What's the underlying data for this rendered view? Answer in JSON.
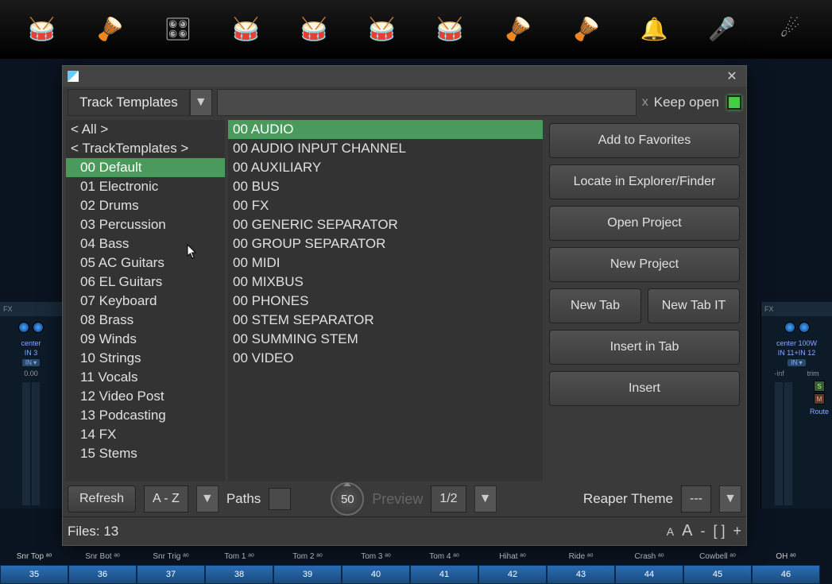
{
  "instruments": [
    "🥁",
    "🪘",
    "🎛",
    "🥁",
    "🥁",
    "🥁",
    "🥁",
    "🪘",
    "🪘",
    "🔔",
    "🎤",
    "☄"
  ],
  "dialog": {
    "type_label": "Track Templates",
    "keep_open": "Keep open",
    "search_clear": "x",
    "categories": [
      {
        "label": "< All >",
        "indent": false,
        "selected": false
      },
      {
        "label": "< TrackTemplates >",
        "indent": false,
        "selected": false
      },
      {
        "label": "00 Default",
        "indent": true,
        "selected": true
      },
      {
        "label": "01 Electronic",
        "indent": true,
        "selected": false
      },
      {
        "label": "02 Drums",
        "indent": true,
        "selected": false
      },
      {
        "label": "03 Percussion",
        "indent": true,
        "selected": false
      },
      {
        "label": "04 Bass",
        "indent": true,
        "selected": false
      },
      {
        "label": "05 AC Guitars",
        "indent": true,
        "selected": false
      },
      {
        "label": "06 EL Guitars",
        "indent": true,
        "selected": false
      },
      {
        "label": "07 Keyboard",
        "indent": true,
        "selected": false
      },
      {
        "label": "08 Brass",
        "indent": true,
        "selected": false
      },
      {
        "label": "09 Winds",
        "indent": true,
        "selected": false
      },
      {
        "label": "10 Strings",
        "indent": true,
        "selected": false
      },
      {
        "label": "11 Vocals",
        "indent": true,
        "selected": false
      },
      {
        "label": "12 Video Post",
        "indent": true,
        "selected": false
      },
      {
        "label": "13 Podcasting",
        "indent": true,
        "selected": false
      },
      {
        "label": "14 FX",
        "indent": true,
        "selected": false
      },
      {
        "label": "15 Stems",
        "indent": true,
        "selected": false
      }
    ],
    "templates": [
      {
        "label": "00 AUDIO",
        "selected": true
      },
      {
        "label": "00 AUDIO INPUT CHANNEL",
        "selected": false
      },
      {
        "label": "00 AUXILIARY",
        "selected": false
      },
      {
        "label": "00 BUS",
        "selected": false
      },
      {
        "label": "00 FX",
        "selected": false
      },
      {
        "label": "00 GENERIC SEPARATOR",
        "selected": false
      },
      {
        "label": "00 GROUP SEPARATOR",
        "selected": false
      },
      {
        "label": "00 MIDI",
        "selected": false
      },
      {
        "label": "00 MIXBUS",
        "selected": false
      },
      {
        "label": "00 PHONES",
        "selected": false
      },
      {
        "label": "00 STEM SEPARATOR",
        "selected": false
      },
      {
        "label": "00 SUMMING STEM",
        "selected": false
      },
      {
        "label": "00 VIDEO",
        "selected": false
      }
    ],
    "actions": {
      "add_fav": "Add to Favorites",
      "locate": "Locate in Explorer/Finder",
      "open_proj": "Open Project",
      "new_proj": "New Project",
      "new_tab": "New Tab",
      "new_tab_it": "New Tab IT",
      "insert_tab": "Insert in Tab",
      "insert": "Insert"
    },
    "footer": {
      "refresh": "Refresh",
      "sort": "A - Z",
      "paths": "Paths",
      "count": "50",
      "preview": "Preview",
      "fraction": "1/2",
      "theme": "Reaper Theme",
      "theme_val": "---"
    },
    "status": {
      "files": "Files: 13",
      "minus": "-",
      "brackets": "[  ]",
      "plus": "+"
    }
  },
  "left_channel": {
    "fx": "FX",
    "center": "center",
    "in": "IN 3",
    "in_badge": "IN ▾",
    "db": "0.00"
  },
  "right_channel": {
    "fx": "FX",
    "center": "center",
    "watt": "100W",
    "in": "IN 11+IN 12",
    "in_badge": "IN ▾",
    "minf": "-inf",
    "trim": "trim",
    "route": "Route",
    "s": "S",
    "m": "M"
  },
  "track_labels": [
    "Snr Top ᵃᵒ",
    "Snr Bot ᵃᵒ",
    "Snr Trig ᵃᵒ",
    "Tom 1 ᵃᵒ",
    "Tom 2 ᵃᵒ",
    "Tom 3 ᵃᵒ",
    "Tom 4 ᵃᵒ",
    "Hihat ᵃᵒ",
    "Ride ᵃᵒ",
    "Crash ᵃᵒ",
    "Cowbell ᵃᵒ",
    "OH ᵃᵒ"
  ],
  "track_nums": [
    "35",
    "36",
    "37",
    "38",
    "39",
    "40",
    "41",
    "42",
    "43",
    "44",
    "45",
    "46"
  ]
}
